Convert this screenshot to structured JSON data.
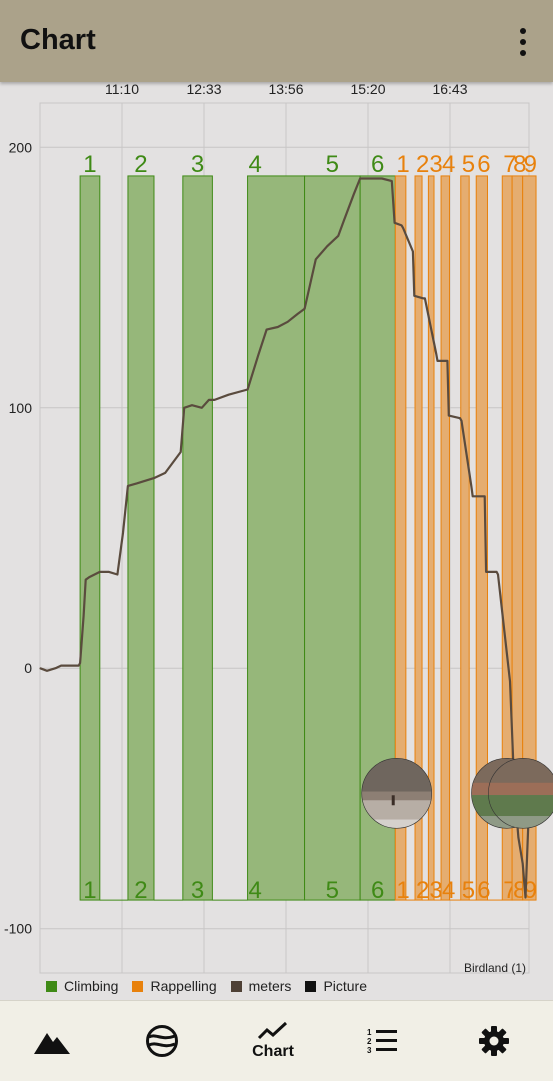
{
  "app": {
    "title": "Chart"
  },
  "nav": {
    "chart_label": "Chart"
  },
  "chart_data": {
    "type": "line",
    "x_ticks": [
      "11:10",
      "12:33",
      "13:56",
      "15:20",
      "16:43"
    ],
    "y_ticks": [
      200,
      100,
      0,
      -100
    ],
    "ylim": [
      -117,
      217
    ],
    "grid": true,
    "watermark": "Birdland (1)",
    "legend": [
      {
        "name": "Climbing",
        "color": "#3f8a16"
      },
      {
        "name": "Rappelling",
        "color": "#e8810c"
      },
      {
        "name": "meters",
        "color": "#4e4035"
      },
      {
        "name": "Picture",
        "color": "#111111"
      }
    ],
    "colors": {
      "climb_fill": "#96b77a",
      "climb_line": "#3f8a16",
      "rap_fill": "#e5ad70",
      "rap_line": "#e8810c",
      "trace": "#5a4b3e"
    },
    "band_top": 189,
    "band_bottom": -89,
    "climbs": [
      {
        "label": "1",
        "start": 10.57,
        "end": 10.85
      },
      {
        "label": "2",
        "start": 11.25,
        "end": 11.62
      },
      {
        "label": "3",
        "start": 12.03,
        "end": 12.45
      },
      {
        "label": "4",
        "start": 12.95,
        "end": 13.76
      },
      {
        "label": "5",
        "start": 13.76,
        "end": 14.55
      },
      {
        "label": "6",
        "start": 14.55,
        "end": 15.05
      }
    ],
    "rappels": [
      {
        "label": "1",
        "start": 15.05,
        "end": 15.2
      },
      {
        "label": "2",
        "start": 15.33,
        "end": 15.43
      },
      {
        "label": "3",
        "start": 15.52,
        "end": 15.6
      },
      {
        "label": "4",
        "start": 15.7,
        "end": 15.82
      },
      {
        "label": "5",
        "start": 15.98,
        "end": 16.1
      },
      {
        "label": "6",
        "start": 16.2,
        "end": 16.36
      },
      {
        "label": "7",
        "start": 16.57,
        "end": 16.71
      },
      {
        "label": "8",
        "start": 16.71,
        "end": 16.86
      },
      {
        "label": "9",
        "start": 16.86,
        "end": 17.05
      }
    ],
    "pictures": [
      {
        "t": 15.07,
        "v": -48,
        "scene": "crag"
      },
      {
        "t": 16.63,
        "v": -48,
        "scene": "rock"
      },
      {
        "t": 16.87,
        "v": -48,
        "scene": "rock"
      }
    ],
    "series": [
      {
        "name": "meters",
        "x": [
          10.0,
          10.1,
          10.22,
          10.3,
          10.42,
          10.55,
          10.57,
          10.62,
          10.65,
          10.7,
          10.85,
          10.98,
          11.1,
          11.18,
          11.25,
          11.38,
          11.5,
          11.62,
          11.78,
          12.0,
          12.05,
          12.16,
          12.3,
          12.4,
          12.48,
          12.68,
          12.95,
          13.1,
          13.22,
          13.38,
          13.52,
          13.66,
          13.76,
          13.92,
          14.08,
          14.24,
          14.32,
          14.46,
          14.55,
          14.72,
          14.86,
          15.0,
          15.04,
          15.14,
          15.16,
          15.3,
          15.32,
          15.45,
          15.47,
          15.63,
          15.65,
          15.79,
          15.81,
          15.97,
          15.99,
          16.13,
          16.15,
          16.32,
          16.34,
          16.49,
          16.51,
          16.68,
          16.74,
          16.8,
          16.86,
          16.9,
          16.94
        ],
        "values": [
          0,
          -1,
          0,
          1,
          1,
          1,
          2,
          20,
          34,
          35,
          37,
          37,
          36,
          52,
          70,
          71,
          72,
          73,
          75,
          83,
          100,
          101,
          100,
          103,
          103,
          105,
          107,
          120,
          130,
          131,
          133,
          136,
          138,
          157,
          162,
          166,
          172,
          182,
          188,
          188,
          188,
          187,
          171,
          170,
          169,
          160,
          143,
          142,
          142,
          121,
          118,
          118,
          97,
          96,
          95,
          70,
          66,
          66,
          37,
          37,
          36,
          -5,
          -45,
          -65,
          -75,
          -88,
          -60
        ]
      }
    ]
  }
}
